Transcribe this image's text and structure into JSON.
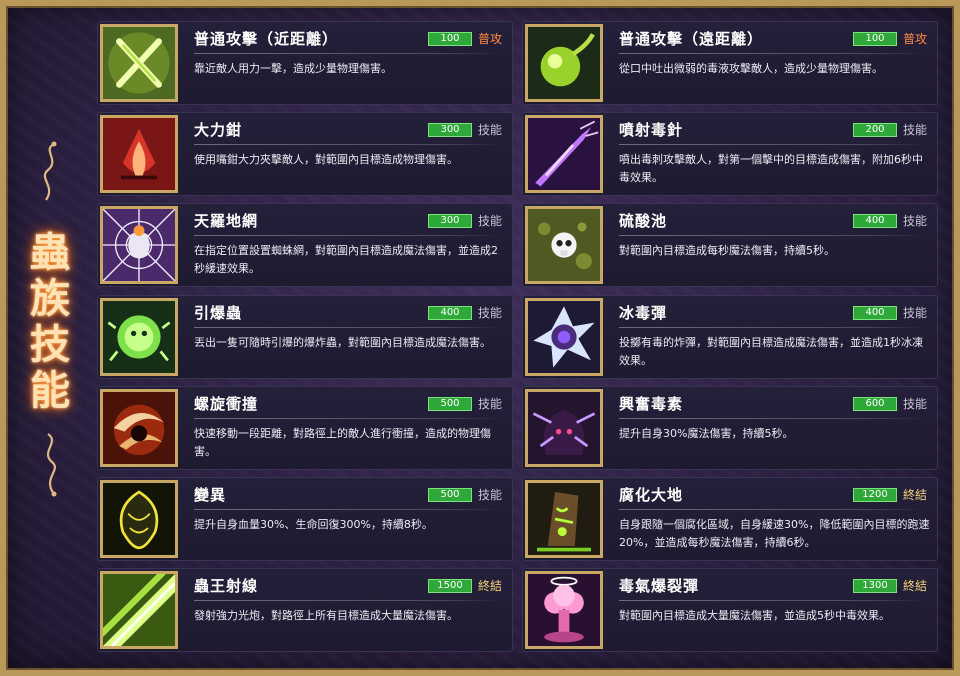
{
  "page_title_chars": [
    "蟲",
    "族",
    "技",
    "能"
  ],
  "skills": [
    {
      "name": "普通攻擊（近距離）",
      "cost": "100",
      "type": "普攻",
      "desc": "靠近敵人用力一擊，造成少量物理傷害。",
      "icon": "claw-slash-icon"
    },
    {
      "name": "普通攻擊（遠距離）",
      "cost": "100",
      "type": "普攻",
      "desc": "從口中吐出微弱的毒液攻擊敵人，造成少量物理傷害。",
      "icon": "poison-spit-icon"
    },
    {
      "name": "大力鉗",
      "cost": "300",
      "type": "技能",
      "desc": "使用嘴鉗大力夾擊敵人，對範圍內目標造成物理傷害。",
      "icon": "pincer-icon"
    },
    {
      "name": "噴射毒針",
      "cost": "200",
      "type": "技能",
      "desc": "噴出毒刺攻擊敵人，對第一個擊中的目標造成傷害，附加6秒中毒效果。",
      "icon": "poison-needle-icon"
    },
    {
      "name": "天羅地網",
      "cost": "300",
      "type": "技能",
      "desc": "在指定位置設置蜘蛛網，對範圍內目標造成魔法傷害，並造成2秒緩速效果。",
      "icon": "spider-web-icon"
    },
    {
      "name": "硫酸池",
      "cost": "400",
      "type": "技能",
      "desc": "對範圍內目標造成每秒魔法傷害，持續5秒。",
      "icon": "acid-pool-icon"
    },
    {
      "name": "引爆蟲",
      "cost": "400",
      "type": "技能",
      "desc": "丟出一隻可隨時引爆的爆炸蟲，對範圍內目標造成魔法傷害。",
      "icon": "bomb-bug-icon"
    },
    {
      "name": "冰毒彈",
      "cost": "400",
      "type": "技能",
      "desc": "投擲有毒的炸彈，對範圍內目標造成魔法傷害，並造成1秒冰凍效果。",
      "icon": "ice-poison-bomb-icon"
    },
    {
      "name": "螺旋衝撞",
      "cost": "500",
      "type": "技能",
      "desc": "快速移動一段距離，對路徑上的敵人進行衝撞，造成的物理傷害。",
      "icon": "spiral-charge-icon"
    },
    {
      "name": "興奮毒素",
      "cost": "600",
      "type": "技能",
      "desc": "提升自身30%魔法傷害，持續5秒。",
      "icon": "excite-toxin-icon"
    },
    {
      "name": "變異",
      "cost": "500",
      "type": "技能",
      "desc": "提升自身血量30%、生命回復300%，持續8秒。",
      "icon": "mutation-icon"
    },
    {
      "name": "腐化大地",
      "cost": "1200",
      "type": "終結",
      "desc": "自身跟隨一個腐化區域，自身緩速30%，降低範圍內目標的跑速20%，並造成每秒魔法傷害，持續6秒。",
      "icon": "corrupt-ground-icon"
    },
    {
      "name": "蟲王射線",
      "cost": "1500",
      "type": "終結",
      "desc": "發射強力光炮，對路徑上所有目標造成大量魔法傷害。",
      "icon": "bug-king-beam-icon"
    },
    {
      "name": "毒氣爆裂彈",
      "cost": "1300",
      "type": "終結",
      "desc": "對範圍內目標造成大量魔法傷害，並造成5秒中毒效果。",
      "icon": "toxic-burst-icon"
    }
  ],
  "colors": {
    "cost_badge": "#2fa83a",
    "frame_gold": "#b9985a",
    "basic_type": "#ff8a40",
    "ult_type": "#f1d27a"
  }
}
